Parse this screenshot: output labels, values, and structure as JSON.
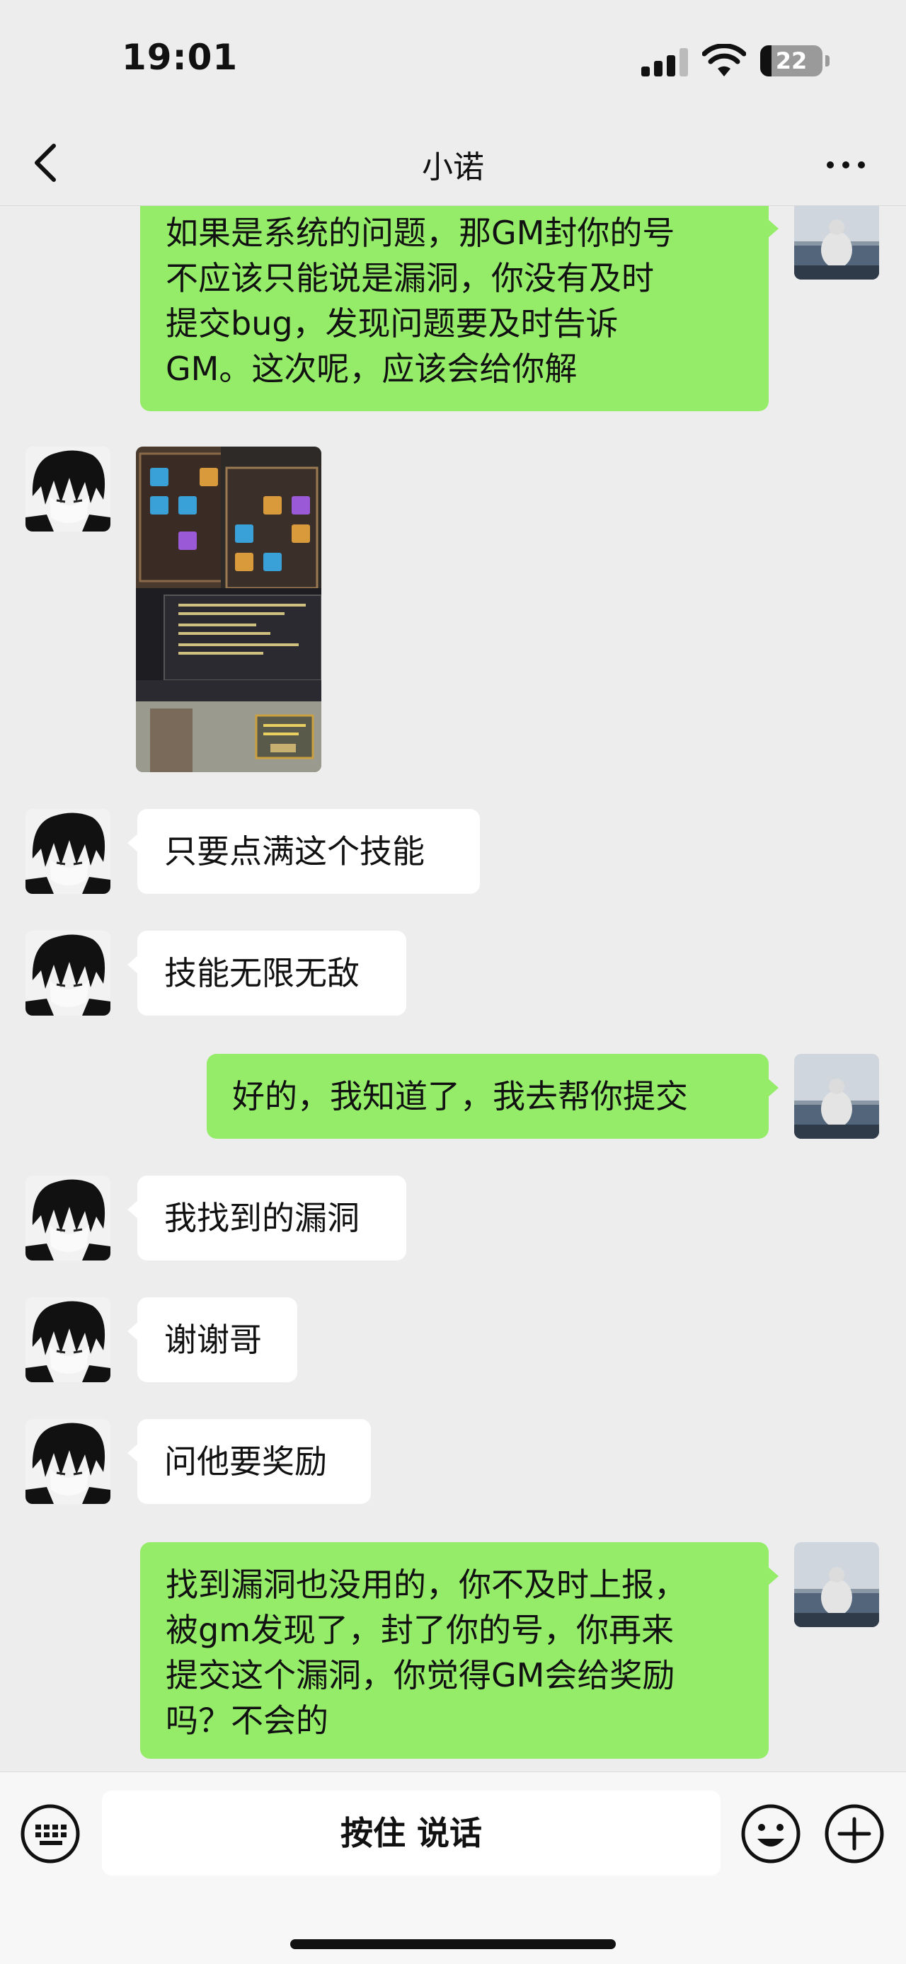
{
  "status_bar": {
    "time": "19:01",
    "battery_level": "22"
  },
  "nav": {
    "title": "小诺"
  },
  "messages": [
    {
      "sender": "me",
      "type": "text",
      "text": "如果是系统的问题，那GM封你的号\n不应该只能说是漏洞，你没有及时\n提交bug，发现问题要及时告诉\nGM。这次呢，应该会给你解"
    },
    {
      "sender": "contact",
      "type": "image"
    },
    {
      "sender": "contact",
      "type": "text",
      "text": "只要点满这个技能"
    },
    {
      "sender": "contact",
      "type": "text",
      "text": "技能无限无敌"
    },
    {
      "sender": "me",
      "type": "text",
      "text": "好的，我知道了，我去帮你提交"
    },
    {
      "sender": "contact",
      "type": "text",
      "text": "我找到的漏洞"
    },
    {
      "sender": "contact",
      "type": "text",
      "text": "谢谢哥"
    },
    {
      "sender": "contact",
      "type": "text",
      "text": "问他要奖励"
    },
    {
      "sender": "me",
      "type": "text",
      "text": "找到漏洞也没用的，你不及时上报，\n被gm发现了，封了你的号，你再来\n提交这个漏洞，你觉得GM会给奖励\n吗？不会的"
    }
  ],
  "input_bar": {
    "hold_to_talk_label": "按住 说话"
  },
  "colors": {
    "background": "#ededed",
    "outgoing_bubble": "#95ec69",
    "incoming_bubble": "#ffffff"
  },
  "icons": [
    "back-chevron-icon",
    "more-dots-icon",
    "keyboard-icon",
    "emoji-icon",
    "plus-icon",
    "signal-icon",
    "wifi-icon",
    "battery-icon"
  ]
}
